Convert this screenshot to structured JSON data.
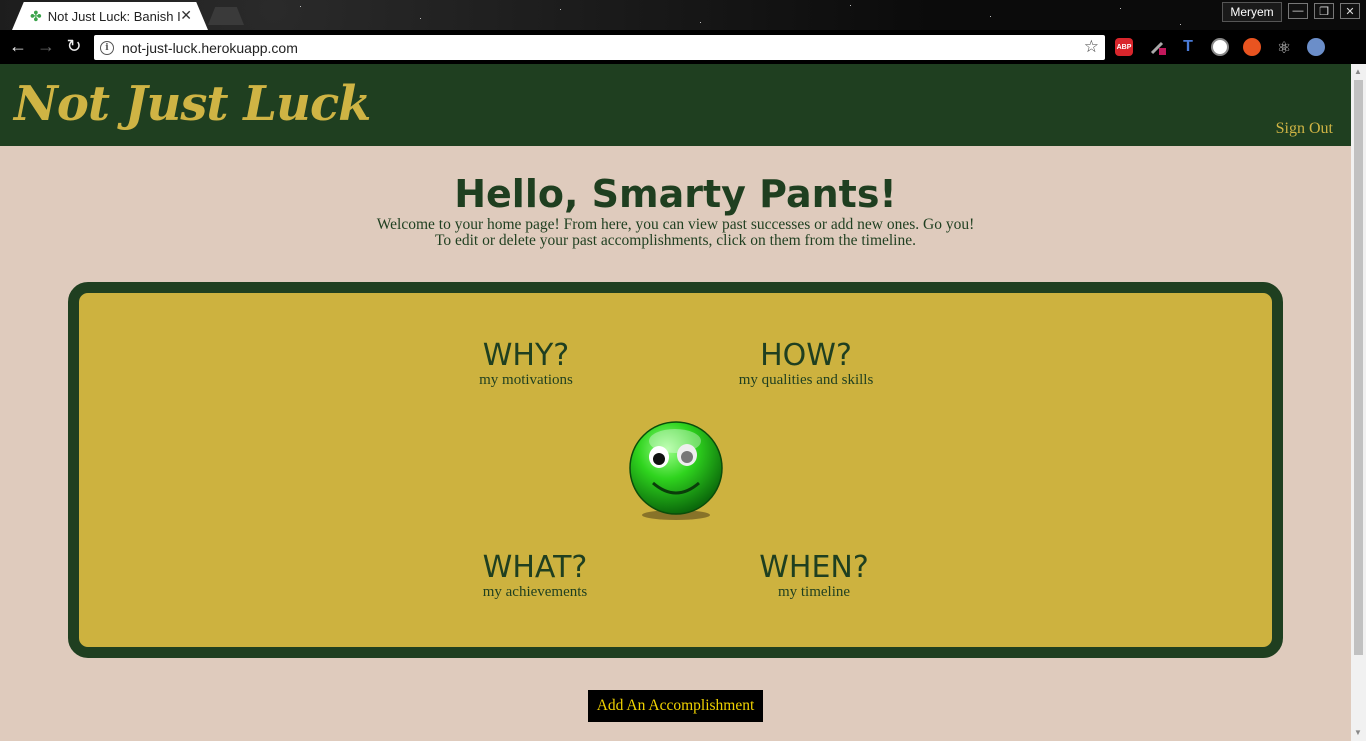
{
  "browser": {
    "tab_title": "Not Just Luck: Banish Im",
    "url": "not-just-luck.herokuapp.com",
    "profile_name": "Meryem",
    "extensions": [
      "adblock-icon",
      "eyedropper-icon",
      "extension-t-icon",
      "circle-icon",
      "ubuntu-icon",
      "react-icon",
      "owl-icon"
    ],
    "colors": {
      "tab_favicon": "#3aa34a"
    }
  },
  "site": {
    "brand": "Not Just Luck",
    "sign_out": "Sign Out"
  },
  "main": {
    "greeting": "Hello, Smarty Pants!",
    "welcome_line1": "Welcome to your home page! From here, you can view past successes or add new ones. Go you!",
    "welcome_line2": "To edit or delete your past accomplishments, click on them from the timeline."
  },
  "panel": {
    "why": {
      "title": "WHY?",
      "subtitle": "my motivations"
    },
    "how": {
      "title": "HOW?",
      "subtitle": "my qualities and skills"
    },
    "what": {
      "title": "WHAT?",
      "subtitle": "my achievements"
    },
    "when": {
      "title": "WHEN?",
      "subtitle": "my timeline"
    }
  },
  "actions": {
    "add_accomplishment": "Add An Accomplishment"
  },
  "colors": {
    "header_green": "#1f3f20",
    "brand_gold": "#cfb444",
    "panel_gold": "#cdb23f",
    "page_bg": "#dfcbbd",
    "button_text": "#f1d300"
  }
}
